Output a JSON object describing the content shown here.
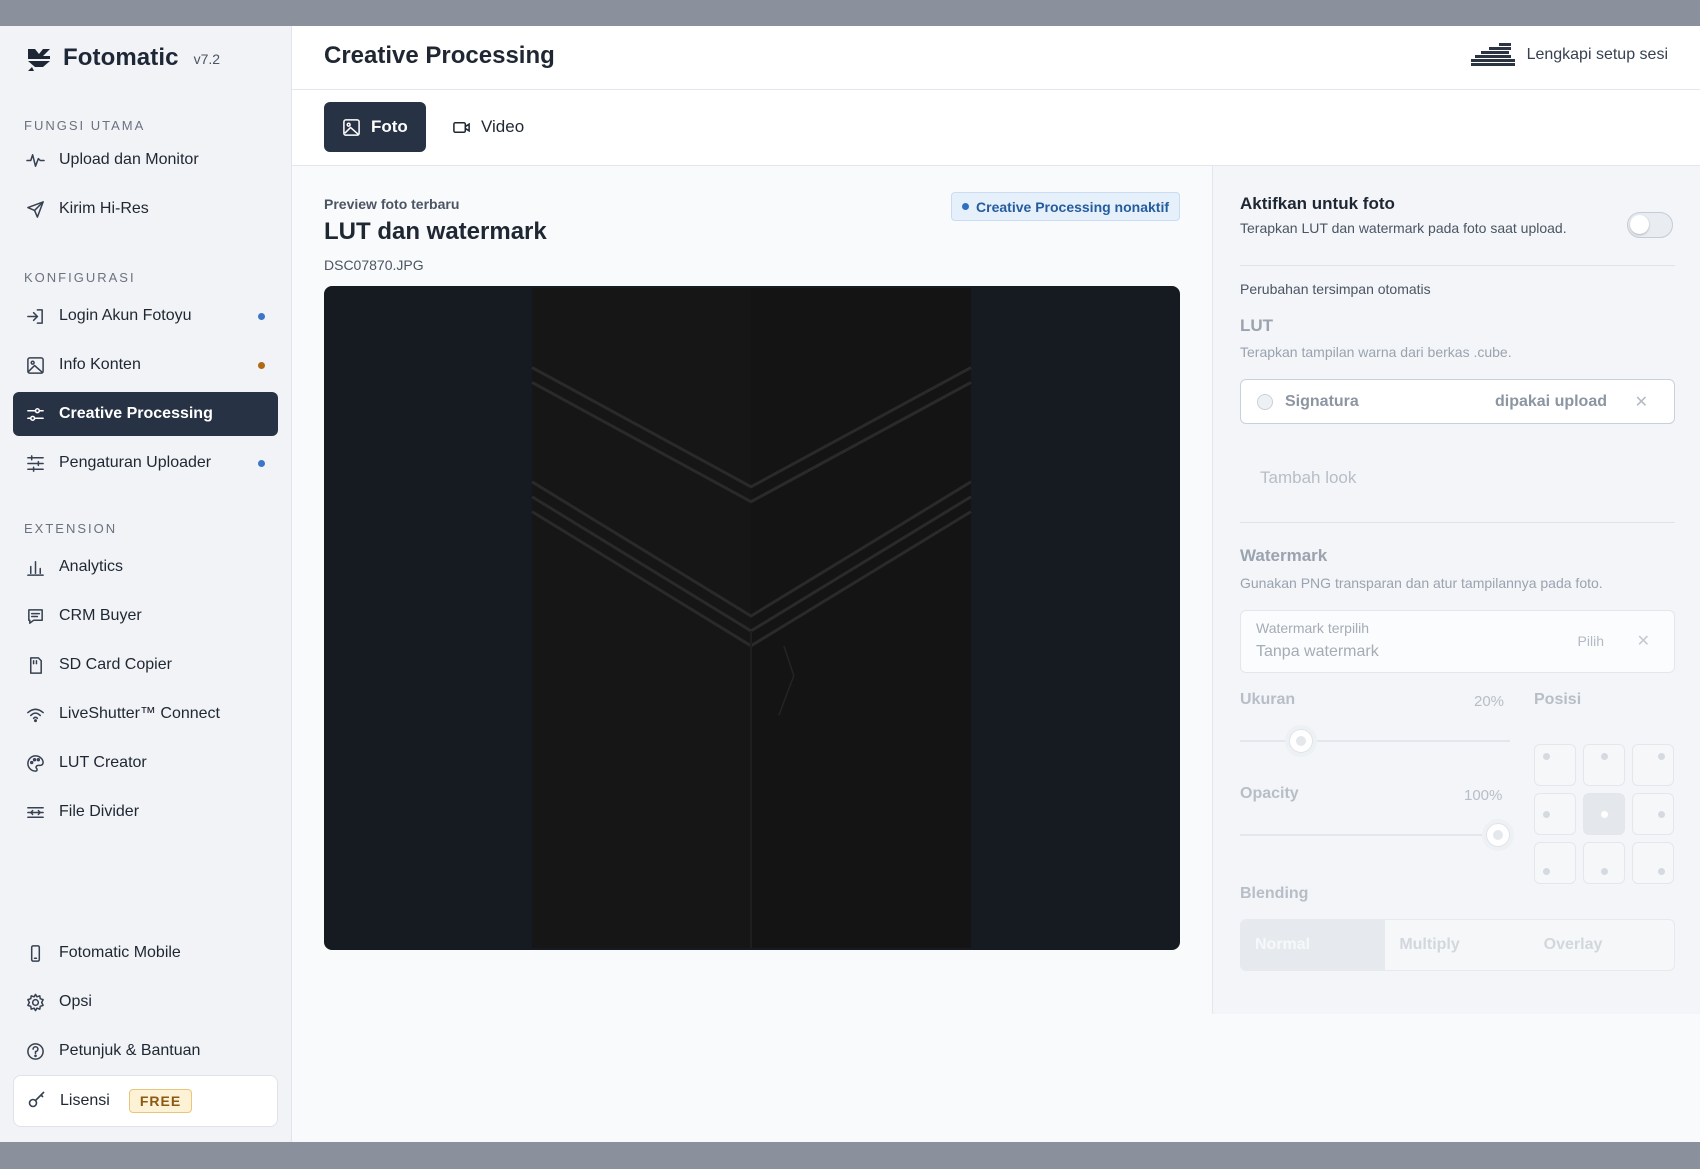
{
  "app": {
    "name": "Fotomatic",
    "version": "v7.2"
  },
  "sidebar": {
    "sections": {
      "main": "FUNGSI UTAMA",
      "config": "KONFIGURASI",
      "extension": "EXTENSION"
    },
    "main_items": [
      {
        "label": "Upload dan Monitor",
        "icon": "activity-icon"
      },
      {
        "label": "Kirim Hi-Res",
        "icon": "send-icon"
      }
    ],
    "config_items": [
      {
        "label": "Login Akun Fotoyu",
        "icon": "login-icon",
        "dot": "#3b76c9"
      },
      {
        "label": "Info Konten",
        "icon": "image-icon",
        "dot": "#b06a14"
      },
      {
        "label": "Creative Processing",
        "icon": "sliders-icon",
        "active": true
      },
      {
        "label": "Pengaturan Uploader",
        "icon": "settings-sliders-icon",
        "dot": "#3b76c9"
      }
    ],
    "extension_items": [
      {
        "label": "Analytics",
        "icon": "bar-chart-icon"
      },
      {
        "label": "CRM Buyer",
        "icon": "message-icon"
      },
      {
        "label": "SD Card Copier",
        "icon": "sd-card-icon"
      },
      {
        "label": "LiveShutter™ Connect",
        "icon": "wifi-icon"
      },
      {
        "label": "LUT Creator",
        "icon": "palette-icon"
      },
      {
        "label": "File Divider",
        "icon": "divider-icon"
      }
    ],
    "bottom_items": [
      {
        "label": "Fotomatic Mobile",
        "icon": "phone-icon"
      },
      {
        "label": "Opsi",
        "icon": "gear-icon"
      },
      {
        "label": "Petunjuk & Bantuan",
        "icon": "help-icon"
      }
    ],
    "license": {
      "label": "Lisensi",
      "badge": "FREE"
    }
  },
  "header": {
    "title": "Creative Processing",
    "setup_label": "Lengkapi setup sesi"
  },
  "tabs": [
    {
      "label": "Foto",
      "active": true
    },
    {
      "label": "Video",
      "active": false
    }
  ],
  "preview": {
    "kicker": "Preview foto terbaru",
    "title": "LUT dan watermark",
    "filename": "DSC07870.JPG",
    "status": "Creative Processing nonaktif"
  },
  "settings": {
    "enable_title": "Aktifkan untuk foto",
    "enable_desc": "Terapkan LUT dan watermark pada foto saat upload.",
    "enabled": false,
    "autosave": "Perubahan tersimpan otomatis",
    "lut": {
      "title": "LUT",
      "desc": "Terapkan tampilan warna dari berkas .cube.",
      "item_name": "Signatura",
      "item_status": "dipakai upload",
      "add_label": "Tambah look"
    },
    "watermark": {
      "title": "Watermark",
      "desc": "Gunakan PNG transparan dan atur tampilannya pada foto.",
      "selected_label": "Watermark terpilih",
      "selected_value": "Tanpa watermark",
      "pick_label": "Pilih",
      "size_label": "Ukuran",
      "size_value": "20%",
      "size_level": 0.2,
      "opacity_label": "Opacity",
      "opacity_value": "100%",
      "opacity_level": 1.0,
      "position_label": "Posisi",
      "position_selected": "center",
      "blending_label": "Blending",
      "blend_modes": [
        "Normal",
        "Multiply",
        "Overlay"
      ],
      "blend_selected": "Normal"
    }
  }
}
